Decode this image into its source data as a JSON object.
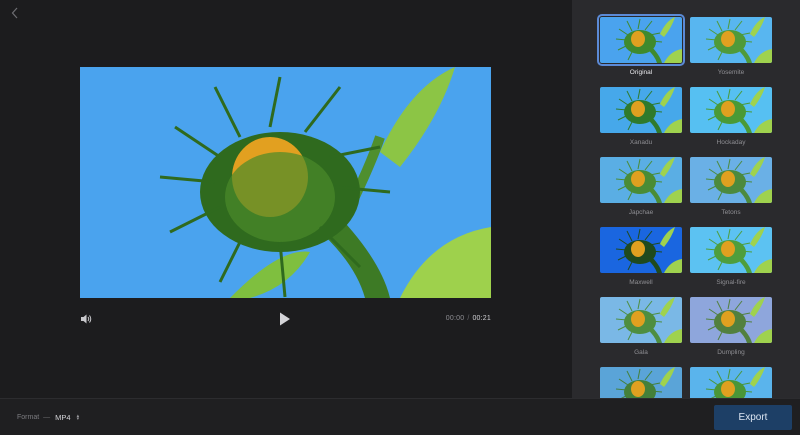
{
  "player": {
    "current_time": "00:00",
    "separator": "/",
    "total_time": "00:21"
  },
  "filters": [
    {
      "label": "Original",
      "selected": true,
      "sky": "#4aa3ee",
      "leaf": "#3f8a2e"
    },
    {
      "label": "Yosemite",
      "selected": false,
      "sky": "#58b6f0",
      "leaf": "#4f9a3a"
    },
    {
      "label": "Xanadu",
      "selected": false,
      "sky": "#46a8ea",
      "leaf": "#2f7a2c"
    },
    {
      "label": "Hockaday",
      "selected": false,
      "sky": "#56c0f2",
      "leaf": "#4a9a36"
    },
    {
      "label": "Japchae",
      "selected": false,
      "sky": "#5aaee4",
      "leaf": "#4a8c36"
    },
    {
      "label": "Tetons",
      "selected": false,
      "sky": "#6ab0e6",
      "leaf": "#4c8a3e"
    },
    {
      "label": "Maxwell",
      "selected": false,
      "sky": "#1a66e0",
      "leaf": "#1f4a1e"
    },
    {
      "label": "Signal-fire",
      "selected": false,
      "sky": "#5cc2f2",
      "leaf": "#4e9e3c"
    },
    {
      "label": "Gala",
      "selected": false,
      "sky": "#7ab8e6",
      "leaf": "#4e8e40"
    },
    {
      "label": "Dumpling",
      "selected": false,
      "sky": "#8ea6dc",
      "leaf": "#52803e"
    },
    {
      "label": "",
      "selected": false,
      "sky": "#5aa4d8",
      "leaf": "#44803a"
    },
    {
      "label": "",
      "selected": false,
      "sky": "#5ab4ec",
      "leaf": "#4a9638"
    }
  ],
  "bottombar": {
    "format_label": "Format",
    "format_dash": "—",
    "format_value": "MP4",
    "export_label": "Export"
  },
  "colors": {
    "accent": "#5b8ad6",
    "export_bg": "#1d3f66",
    "panel_bg": "#2a2a2d",
    "editor_bg": "#1c1c1e"
  },
  "icons": {
    "back": "chevron-left-icon",
    "volume": "volume-icon",
    "play": "play-icon",
    "format_chevrons": "chevron-up-down-icon"
  }
}
